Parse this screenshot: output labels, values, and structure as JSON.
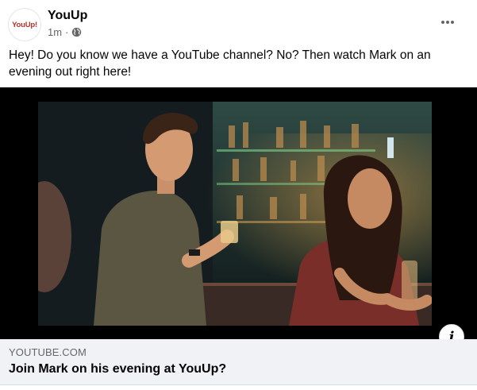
{
  "post": {
    "avatar_text": "YouUp!",
    "page_name": "YouUp",
    "timestamp": "1m",
    "separator": "·",
    "audience_icon": "globe-icon",
    "more_icon": "more-options-icon",
    "text": "Hey! Do you know we have a YouTube channel? No? Then watch Mark on an evening out right here!"
  },
  "link_preview": {
    "domain": "YOUTUBE.COM",
    "title": "Join Mark on his evening at YouUp?",
    "info_label": "i"
  },
  "colors": {
    "brand": "#b8322b",
    "secondary_text": "#65676b",
    "preview_bg": "#f0f2f5"
  }
}
